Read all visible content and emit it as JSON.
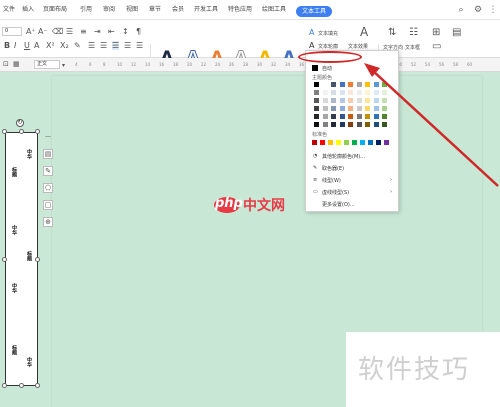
{
  "menubar": {
    "items": [
      "文件",
      "插入",
      "页面布局",
      "引用",
      "审阅",
      "视图",
      "章节",
      "会员",
      "开发工具",
      "特色应用",
      "绘图工具"
    ],
    "active_tab": "文本工具"
  },
  "ribbon": {
    "font_size": "0",
    "text_fill_label": "文本填充",
    "text_outline_label": "文本轮廓",
    "text_effect_label": "文本效果",
    "text_direction_label": "文字方向",
    "text_box_label": "文本框",
    "style_field": "正文",
    "wordart_letter": "A"
  },
  "ruler": {
    "ticks": [
      "4",
      "6",
      "8",
      "10",
      "12",
      "14",
      "16",
      "18",
      "20",
      "22",
      "24",
      "26",
      "28",
      "30",
      "32",
      "34",
      "36",
      "38",
      "40",
      "42",
      "44",
      "46",
      "48",
      "50",
      "52",
      "54",
      "56",
      "58",
      "60"
    ]
  },
  "dropdown": {
    "header": "主题颜色",
    "auto_label": "自动",
    "standard_label": "标准色",
    "items": [
      "其他轮廓颜色(M)...",
      "取色器(E)",
      "线型(W)",
      "虚线线型(S)",
      "更多设置(O)..."
    ],
    "theme_colors": [
      [
        "#000000",
        "#ffffff",
        "#44546a",
        "#4472c4",
        "#ed7d31",
        "#a5a5a5",
        "#ffc000",
        "#5b9bd5",
        "#70ad47"
      ],
      [
        "#7f7f7f",
        "#f2f2f2",
        "#d5dce4",
        "#dae3f3",
        "#fbe5d6",
        "#ededed",
        "#fff2cc",
        "#deebf7",
        "#e2f0d9"
      ],
      [
        "#595959",
        "#d9d9d9",
        "#adb9ca",
        "#b4c7e7",
        "#f8cbad",
        "#dbdbdb",
        "#ffe699",
        "#bdd7ee",
        "#c5e0b4"
      ],
      [
        "#404040",
        "#bfbfbf",
        "#8497b0",
        "#8faadc",
        "#f4b183",
        "#c9c9c9",
        "#ffd966",
        "#9dc3e6",
        "#a9d18e"
      ],
      [
        "#262626",
        "#a6a6a6",
        "#333f50",
        "#2f5597",
        "#c55a11",
        "#7b7b7b",
        "#bf9000",
        "#2e75b6",
        "#548235"
      ],
      [
        "#0d0d0d",
        "#808080",
        "#222a35",
        "#1f3864",
        "#843c0c",
        "#525252",
        "#7f6000",
        "#1f4e79",
        "#385723"
      ]
    ],
    "standard_colors": [
      "#c00000",
      "#ff0000",
      "#ffc000",
      "#ffff00",
      "#92d050",
      "#00b050",
      "#00b0f0",
      "#0070c0",
      "#002060",
      "#7030a0"
    ]
  },
  "textbox": {
    "labels": [
      "中华",
      "标题",
      "中华",
      "标题",
      "中华",
      "标题",
      "中华"
    ]
  },
  "watermark": {
    "php_text": "php",
    "cn_text": "中文网",
    "corner_text": "软件技巧"
  },
  "colors": {
    "accent": "#3d7ef0",
    "annotation_red": "#d02828",
    "doc_background": "#c9e8d6"
  }
}
